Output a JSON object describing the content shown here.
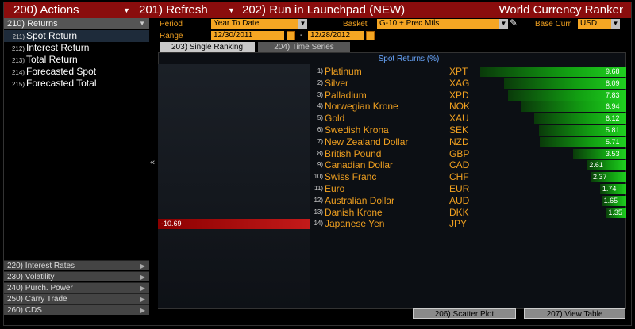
{
  "titlebar": {
    "actions": "200) Actions",
    "refresh": "201) Refresh",
    "launchpad": "202) Run in Launchpad (NEW)",
    "app_name": "World Currency Ranker"
  },
  "sidebar": {
    "header": "210) Returns",
    "items": [
      {
        "num": "211)",
        "label": "Spot Return"
      },
      {
        "num": "212)",
        "label": "Interest Return"
      },
      {
        "num": "213)",
        "label": "Total Return"
      },
      {
        "num": "214)",
        "label": "Forecasted Spot"
      },
      {
        "num": "215)",
        "label": "Forecasted Total"
      }
    ],
    "bottom": [
      "220) Interest Rates",
      "230) Volatility",
      "240) Purch. Power",
      "250) Carry Trade",
      "260) CDS"
    ]
  },
  "controls": {
    "period_label": "Period",
    "period_value": "Year To Date",
    "basket_label": "Basket",
    "basket_value": "G-10 + Prec Mtls",
    "base_label": "Base Curr",
    "base_value": "USD",
    "range_label": "Range",
    "range_start": "12/30/2011",
    "range_sep": "-",
    "range_end": "12/28/2012"
  },
  "tabs": {
    "single": "203) Single Ranking",
    "time_series": "204) Time Series"
  },
  "chart_data": {
    "type": "bar",
    "title": "Spot Returns (%)",
    "ranks": [
      "1)",
      "2)",
      "3)",
      "4)",
      "5)",
      "6)",
      "7)",
      "8)",
      "9)",
      "10)",
      "11)",
      "12)",
      "13)",
      "14)"
    ],
    "categories": [
      "Platinum",
      "Silver",
      "Palladium",
      "Norwegian Krone",
      "Gold",
      "Swedish Krona",
      "New Zealand Dollar",
      "British Pound",
      "Canadian Dollar",
      "Swiss Franc",
      "Euro",
      "Australian Dollar",
      "Danish Krone",
      "Japanese Yen"
    ],
    "codes": [
      "XPT",
      "XAG",
      "XPD",
      "NOK",
      "XAU",
      "SEK",
      "NZD",
      "GBP",
      "CAD",
      "CHF",
      "EUR",
      "AUD",
      "DKK",
      "JPY"
    ],
    "values": [
      9.68,
      8.09,
      7.83,
      6.94,
      6.12,
      5.81,
      5.71,
      3.53,
      2.61,
      2.37,
      1.74,
      1.65,
      1.35,
      -10.69
    ],
    "labels": [
      "9.68",
      "8.09",
      "7.83",
      "6.94",
      "6.12",
      "5.81",
      "5.71",
      "3.53",
      "2.61",
      "2.37",
      "1.74",
      "1.65",
      "1.35",
      "-10.69"
    ],
    "colors": {
      "positive": "#12a012",
      "negative": "#c41a1a"
    }
  },
  "buttons": {
    "scatter": "206) Scatter Plot",
    "view_table": "207) View Table"
  }
}
